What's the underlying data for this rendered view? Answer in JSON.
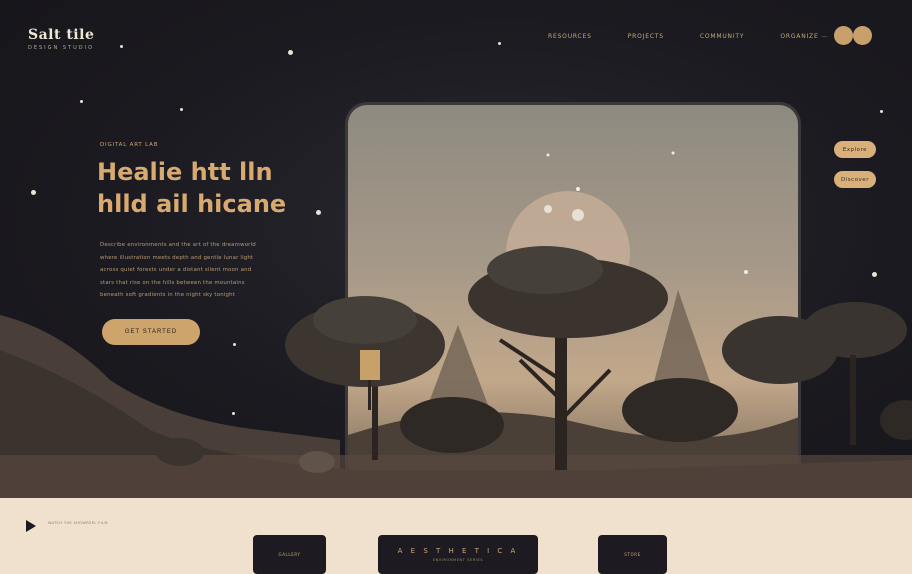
{
  "header": {
    "logo_title": "Salt tile",
    "logo_subtitle": "DESIGN  STUDIO",
    "nav": [
      "RESOURCES",
      "PROJECTS",
      "COMMUNITY",
      "ORGANIZE"
    ],
    "nav_trailing": "—"
  },
  "hero": {
    "eyebrow": "DIGITAL ART LAB",
    "headline_line1": "Healie htt lln",
    "headline_line2": "hlld ail hicane",
    "paragraph": [
      "Describe environments and the art of the dreamworld",
      "where illustration meets depth and gentle lunar light",
      "across quiet forests under a distant silent moon and",
      "stars that rise on the hills between the mountains",
      "beneath soft gradients in the night sky tonight"
    ],
    "cta_label": "GET STARTED"
  },
  "side_pills": [
    "Explore",
    "Discover"
  ],
  "footer": {
    "note": "WATCH THE SHOWREEL FILM",
    "card1_label": "GALLERY",
    "card2_title": "A E S T H E T I C  A",
    "card2_sub": "ENVIRONMENT SERIES",
    "card3_label": "STORE"
  },
  "colors": {
    "background": "#1b1a20",
    "accent": "#cda46c",
    "footer_bg": "#efe1cd"
  },
  "icons": {
    "play": "play-icon"
  }
}
